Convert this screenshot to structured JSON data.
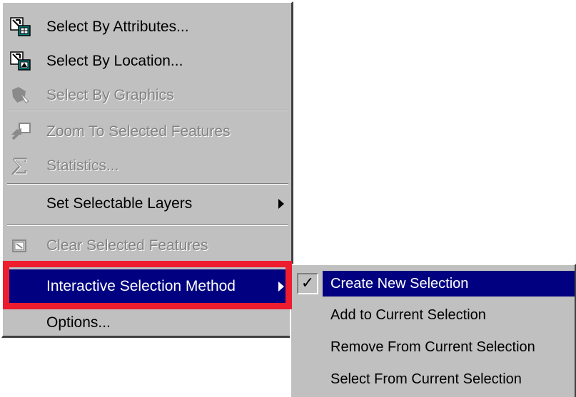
{
  "menu": {
    "items": [
      {
        "label": "Select By Attributes...",
        "icon": "select-by-attributes-icon",
        "enabled": true
      },
      {
        "label": "Select By Location...",
        "icon": "select-by-location-icon",
        "enabled": true
      },
      {
        "label": "Select By Graphics",
        "icon": "select-by-graphics-icon",
        "enabled": false
      },
      {
        "label": "Zoom To Selected Features",
        "icon": "zoom-to-selected-icon",
        "enabled": false
      },
      {
        "label": "Statistics...",
        "icon": "sigma-icon",
        "enabled": false
      },
      {
        "label": "Set Selectable Layers",
        "icon": "",
        "enabled": true,
        "has_submenu": true
      },
      {
        "label": "Clear Selected Features",
        "icon": "clear-selection-icon",
        "enabled": false
      },
      {
        "label": "Interactive Selection Method",
        "icon": "",
        "enabled": true,
        "has_submenu": true,
        "highlighted": true
      },
      {
        "label": "Options...",
        "icon": "",
        "enabled": true
      }
    ]
  },
  "submenu": {
    "items": [
      {
        "label": "Create New Selection",
        "checked": true,
        "highlighted": true
      },
      {
        "label": "Add to Current Selection",
        "checked": false
      },
      {
        "label": "Remove From Current Selection",
        "checked": false
      },
      {
        "label": "Select From Current Selection",
        "checked": false
      }
    ],
    "check_glyph": "✓"
  },
  "colors": {
    "menu_face": "#c0c0c0",
    "highlight": "#000080",
    "annotation": "#ee1c2f",
    "disabled_text": "#828282"
  }
}
